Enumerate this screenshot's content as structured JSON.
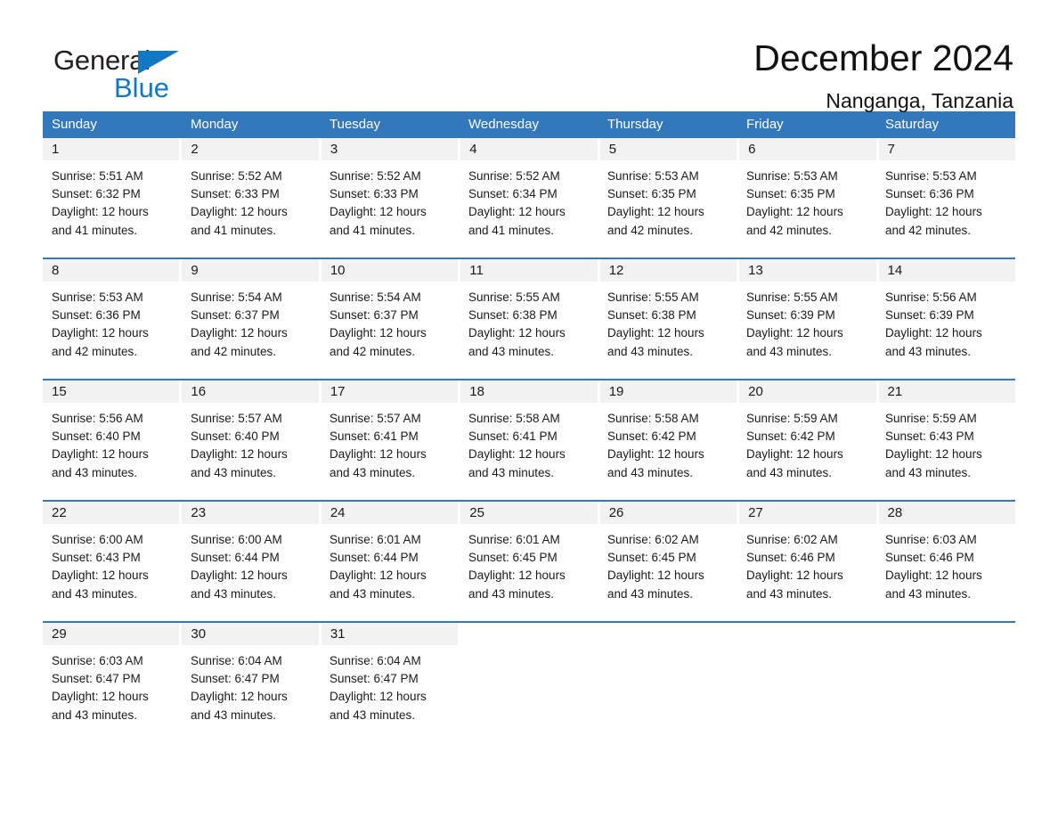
{
  "brand": {
    "name_part1": "General",
    "name_part2": "Blue",
    "triangle_color": "#1378c4"
  },
  "header": {
    "title": "December 2024",
    "subtitle": "Nanganga, Tanzania"
  },
  "theme": {
    "header_blue": "#3478bc",
    "date_band": "#f2f2f2",
    "text": "#1a1a1a"
  },
  "calendar": {
    "day_names": [
      "Sunday",
      "Monday",
      "Tuesday",
      "Wednesday",
      "Thursday",
      "Friday",
      "Saturday"
    ],
    "weeks": [
      {
        "dates": [
          "1",
          "2",
          "3",
          "4",
          "5",
          "6",
          "7"
        ],
        "cells": [
          {
            "sunrise": "Sunrise: 5:51 AM",
            "sunset": "Sunset: 6:32 PM",
            "daylight_line1": "Daylight: 12 hours",
            "daylight_line2": "and 41 minutes."
          },
          {
            "sunrise": "Sunrise: 5:52 AM",
            "sunset": "Sunset: 6:33 PM",
            "daylight_line1": "Daylight: 12 hours",
            "daylight_line2": "and 41 minutes."
          },
          {
            "sunrise": "Sunrise: 5:52 AM",
            "sunset": "Sunset: 6:33 PM",
            "daylight_line1": "Daylight: 12 hours",
            "daylight_line2": "and 41 minutes."
          },
          {
            "sunrise": "Sunrise: 5:52 AM",
            "sunset": "Sunset: 6:34 PM",
            "daylight_line1": "Daylight: 12 hours",
            "daylight_line2": "and 41 minutes."
          },
          {
            "sunrise": "Sunrise: 5:53 AM",
            "sunset": "Sunset: 6:35 PM",
            "daylight_line1": "Daylight: 12 hours",
            "daylight_line2": "and 42 minutes."
          },
          {
            "sunrise": "Sunrise: 5:53 AM",
            "sunset": "Sunset: 6:35 PM",
            "daylight_line1": "Daylight: 12 hours",
            "daylight_line2": "and 42 minutes."
          },
          {
            "sunrise": "Sunrise: 5:53 AM",
            "sunset": "Sunset: 6:36 PM",
            "daylight_line1": "Daylight: 12 hours",
            "daylight_line2": "and 42 minutes."
          }
        ]
      },
      {
        "dates": [
          "8",
          "9",
          "10",
          "11",
          "12",
          "13",
          "14"
        ],
        "cells": [
          {
            "sunrise": "Sunrise: 5:53 AM",
            "sunset": "Sunset: 6:36 PM",
            "daylight_line1": "Daylight: 12 hours",
            "daylight_line2": "and 42 minutes."
          },
          {
            "sunrise": "Sunrise: 5:54 AM",
            "sunset": "Sunset: 6:37 PM",
            "daylight_line1": "Daylight: 12 hours",
            "daylight_line2": "and 42 minutes."
          },
          {
            "sunrise": "Sunrise: 5:54 AM",
            "sunset": "Sunset: 6:37 PM",
            "daylight_line1": "Daylight: 12 hours",
            "daylight_line2": "and 42 minutes."
          },
          {
            "sunrise": "Sunrise: 5:55 AM",
            "sunset": "Sunset: 6:38 PM",
            "daylight_line1": "Daylight: 12 hours",
            "daylight_line2": "and 43 minutes."
          },
          {
            "sunrise": "Sunrise: 5:55 AM",
            "sunset": "Sunset: 6:38 PM",
            "daylight_line1": "Daylight: 12 hours",
            "daylight_line2": "and 43 minutes."
          },
          {
            "sunrise": "Sunrise: 5:55 AM",
            "sunset": "Sunset: 6:39 PM",
            "daylight_line1": "Daylight: 12 hours",
            "daylight_line2": "and 43 minutes."
          },
          {
            "sunrise": "Sunrise: 5:56 AM",
            "sunset": "Sunset: 6:39 PM",
            "daylight_line1": "Daylight: 12 hours",
            "daylight_line2": "and 43 minutes."
          }
        ]
      },
      {
        "dates": [
          "15",
          "16",
          "17",
          "18",
          "19",
          "20",
          "21"
        ],
        "cells": [
          {
            "sunrise": "Sunrise: 5:56 AM",
            "sunset": "Sunset: 6:40 PM",
            "daylight_line1": "Daylight: 12 hours",
            "daylight_line2": "and 43 minutes."
          },
          {
            "sunrise": "Sunrise: 5:57 AM",
            "sunset": "Sunset: 6:40 PM",
            "daylight_line1": "Daylight: 12 hours",
            "daylight_line2": "and 43 minutes."
          },
          {
            "sunrise": "Sunrise: 5:57 AM",
            "sunset": "Sunset: 6:41 PM",
            "daylight_line1": "Daylight: 12 hours",
            "daylight_line2": "and 43 minutes."
          },
          {
            "sunrise": "Sunrise: 5:58 AM",
            "sunset": "Sunset: 6:41 PM",
            "daylight_line1": "Daylight: 12 hours",
            "daylight_line2": "and 43 minutes."
          },
          {
            "sunrise": "Sunrise: 5:58 AM",
            "sunset": "Sunset: 6:42 PM",
            "daylight_line1": "Daylight: 12 hours",
            "daylight_line2": "and 43 minutes."
          },
          {
            "sunrise": "Sunrise: 5:59 AM",
            "sunset": "Sunset: 6:42 PM",
            "daylight_line1": "Daylight: 12 hours",
            "daylight_line2": "and 43 minutes."
          },
          {
            "sunrise": "Sunrise: 5:59 AM",
            "sunset": "Sunset: 6:43 PM",
            "daylight_line1": "Daylight: 12 hours",
            "daylight_line2": "and 43 minutes."
          }
        ]
      },
      {
        "dates": [
          "22",
          "23",
          "24",
          "25",
          "26",
          "27",
          "28"
        ],
        "cells": [
          {
            "sunrise": "Sunrise: 6:00 AM",
            "sunset": "Sunset: 6:43 PM",
            "daylight_line1": "Daylight: 12 hours",
            "daylight_line2": "and 43 minutes."
          },
          {
            "sunrise": "Sunrise: 6:00 AM",
            "sunset": "Sunset: 6:44 PM",
            "daylight_line1": "Daylight: 12 hours",
            "daylight_line2": "and 43 minutes."
          },
          {
            "sunrise": "Sunrise: 6:01 AM",
            "sunset": "Sunset: 6:44 PM",
            "daylight_line1": "Daylight: 12 hours",
            "daylight_line2": "and 43 minutes."
          },
          {
            "sunrise": "Sunrise: 6:01 AM",
            "sunset": "Sunset: 6:45 PM",
            "daylight_line1": "Daylight: 12 hours",
            "daylight_line2": "and 43 minutes."
          },
          {
            "sunrise": "Sunrise: 6:02 AM",
            "sunset": "Sunset: 6:45 PM",
            "daylight_line1": "Daylight: 12 hours",
            "daylight_line2": "and 43 minutes."
          },
          {
            "sunrise": "Sunrise: 6:02 AM",
            "sunset": "Sunset: 6:46 PM",
            "daylight_line1": "Daylight: 12 hours",
            "daylight_line2": "and 43 minutes."
          },
          {
            "sunrise": "Sunrise: 6:03 AM",
            "sunset": "Sunset: 6:46 PM",
            "daylight_line1": "Daylight: 12 hours",
            "daylight_line2": "and 43 minutes."
          }
        ]
      },
      {
        "dates": [
          "29",
          "30",
          "31",
          "",
          "",
          "",
          ""
        ],
        "cells": [
          {
            "sunrise": "Sunrise: 6:03 AM",
            "sunset": "Sunset: 6:47 PM",
            "daylight_line1": "Daylight: 12 hours",
            "daylight_line2": "and 43 minutes."
          },
          {
            "sunrise": "Sunrise: 6:04 AM",
            "sunset": "Sunset: 6:47 PM",
            "daylight_line1": "Daylight: 12 hours",
            "daylight_line2": "and 43 minutes."
          },
          {
            "sunrise": "Sunrise: 6:04 AM",
            "sunset": "Sunset: 6:47 PM",
            "daylight_line1": "Daylight: 12 hours",
            "daylight_line2": "and 43 minutes."
          },
          {
            "sunrise": "",
            "sunset": "",
            "daylight_line1": "",
            "daylight_line2": ""
          },
          {
            "sunrise": "",
            "sunset": "",
            "daylight_line1": "",
            "daylight_line2": ""
          },
          {
            "sunrise": "",
            "sunset": "",
            "daylight_line1": "",
            "daylight_line2": ""
          },
          {
            "sunrise": "",
            "sunset": "",
            "daylight_line1": "",
            "daylight_line2": ""
          }
        ]
      }
    ]
  }
}
